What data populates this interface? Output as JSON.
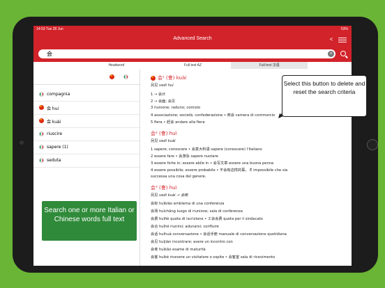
{
  "status": {
    "time": "14:53",
    "date": "Tue 28 Jun",
    "battery": "53%"
  },
  "navbar": {
    "title": "Advanced Search"
  },
  "search": {
    "value": "会",
    "clear_icon": "clear-icon",
    "search_icon": "search-icon"
  },
  "tabs": [
    {
      "label": "Headword"
    },
    {
      "label": "Full text AZ"
    },
    {
      "label": "Full text 汉语",
      "active": true
    }
  ],
  "sidebar": {
    "items": [
      {
        "flag": "it",
        "label": "compagnia"
      },
      {
        "flag": "cn",
        "label": "会 hui"
      },
      {
        "flag": "cn",
        "label": "会 kuài"
      },
      {
        "flag": "it",
        "label": "riuscire"
      },
      {
        "flag": "it",
        "label": "sapere (1)"
      },
      {
        "flag": "it",
        "label": "seduta"
      }
    ]
  },
  "entries": {
    "e1": {
      "headword": "会¹ (會) kuài",
      "alt": "另见",
      "alt_ref": "vedi huì",
      "senses": [
        "1 → 会计",
        "2 → 会面; 会见",
        "3 riunione; raduno; comizio",
        "4 associazione; società; confederazione • 商会 camera di commercio",
        "5 fiera • 赶会 andare alla fiera"
      ]
    },
    "e2": {
      "headword": "会² (會) huì",
      "alt": "另见",
      "alt_ref": "vedi kuài",
      "senses": [
        "1 sapere; conoscere • 会意大利语 sapere (conoscere) l'italiano",
        "2 essere fare • 会游泳 sapere nuotare",
        "3 essere forte in; essere abile in • 会写文章 essere una buona penna",
        "4 essere possibile; essere probabile • 不会有这样的事。 È impossibile che sia",
        "successa una cosa del genere."
      ]
    },
    "e3": {
      "headword": "会³ (會) huì",
      "alt": "另见",
      "alt_ref": "vedi kuài → 会账",
      "compounds": [
        "会标 huìbiāo emblema di una conferenza",
        "会场 huìchǎng luogo di riunione; sala di conferenza",
        "会费 huìfèi quota di iscrizione • 工会会费 quota per il sindacato",
        "会合 huìhé riunirsi; adunarsi; confluire",
        "会话 huìhuà conversazione • 会话手册 manuale di conversazione quotidiana",
        "会见 huìjiàn incontrare; avere un incontro con",
        "会考 huìkǎo esame di maturità",
        "会客 huìkè ricevere un visitatore o ospite • 会客室 sala di ricevimento"
      ]
    }
  },
  "callouts": {
    "clear": "Select this button to delete and reset the search criteria",
    "fulltext": "Search one or more Italian or Chinese words full text"
  }
}
